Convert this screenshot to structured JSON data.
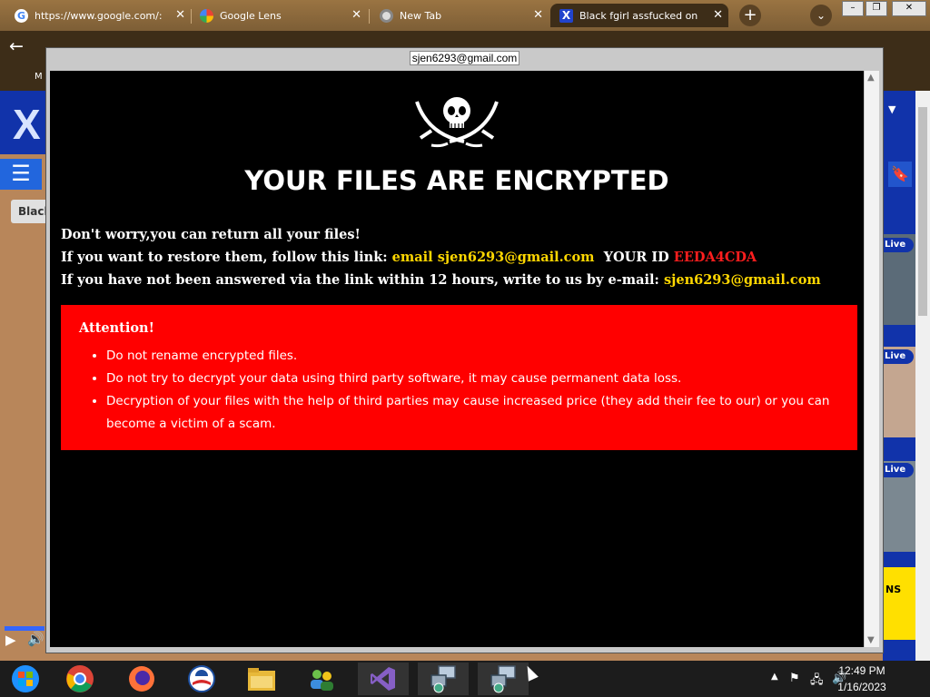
{
  "browser": {
    "tabs": [
      {
        "label": "https://www.google.com/:",
        "icon": "google-icon"
      },
      {
        "label": "Google Lens",
        "icon": "google-lens-icon"
      },
      {
        "label": "New Tab",
        "icon": "chrome-icon"
      },
      {
        "label": "Black fgirl assfucked on",
        "icon": "x-site-icon"
      }
    ],
    "bookmark_partial": "M",
    "site_pill_label": "Black",
    "live_badge": "Live",
    "banner_partial": "NS"
  },
  "ransom": {
    "window_title": "sjen6293@gmail.com",
    "heading": "YOUR FILES ARE ENCRYPTED",
    "line1": "Don't worry,you can return all your files!",
    "line2_prefix": "If you want to restore them, follow this link:",
    "line2_email_label": "email sjen6293@gmail.com",
    "line2_id_label": "YOUR ID",
    "line2_id_value": "EEDA4CDA",
    "line3_prefix": "If you have not been answered via the link within 12 hours, write to us by e-mail:",
    "line3_email": "sjen6293@gmail.com",
    "attention_title": "Attention!",
    "attention_items": [
      "Do not rename encrypted files.",
      "Do not try to decrypt your data using third party software, it may cause permanent data loss.",
      "Decryption of your files with the help of third parties may cause increased price (they add their fee to our) or you can become a victim of a scam."
    ]
  },
  "taskbar": {
    "apps": [
      "start-icon",
      "chrome-icon",
      "firefox-icon",
      "obama-icon",
      "file-explorer-icon",
      "network-users-icon",
      "visual-studio-icon",
      "remote-desktop-icon",
      "remote-desktop-icon"
    ],
    "time": "12:49 PM",
    "date": "1/16/2023"
  },
  "colors": {
    "warning_red": "#ff0000",
    "link_yellow": "#ffd700",
    "id_red": "#ff1e1e"
  }
}
